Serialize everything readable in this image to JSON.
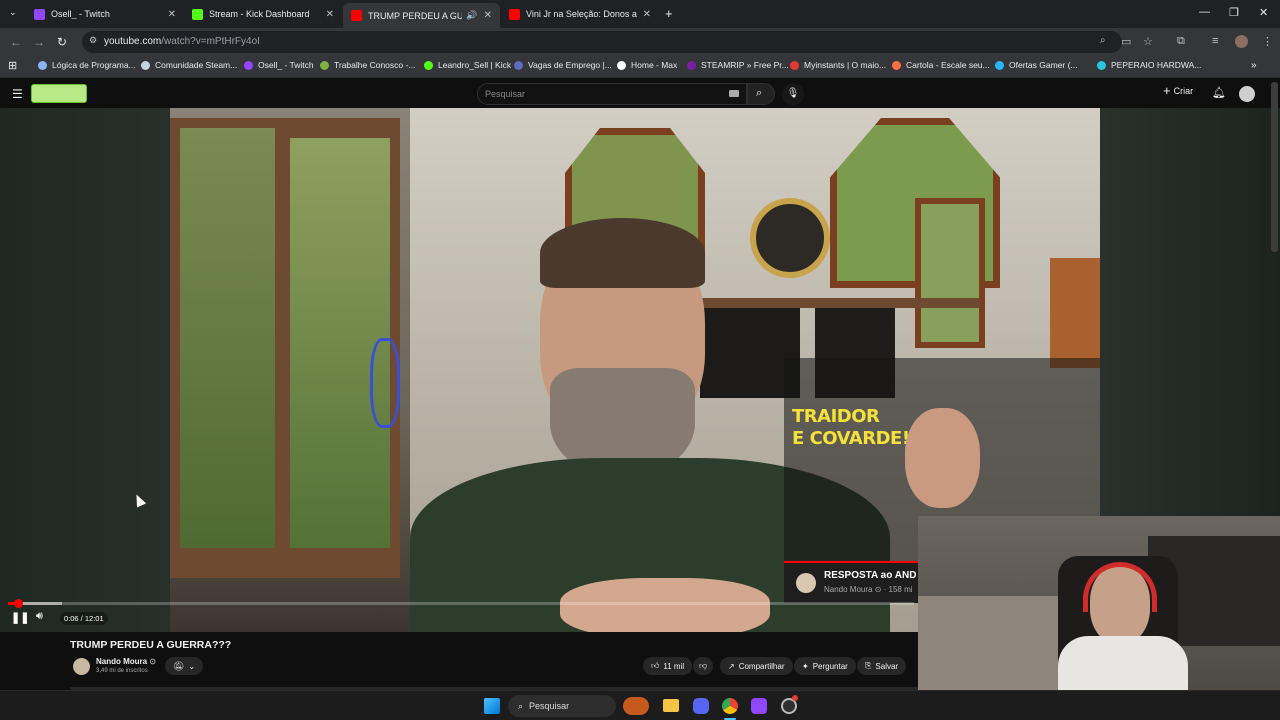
{
  "browser": {
    "tabs": [
      {
        "label": "Osell_ - Twitch",
        "color": "#9146ff"
      },
      {
        "label": "Stream - Kick Dashboard",
        "color": "#53fc18"
      },
      {
        "label": "TRUMP PERDEU A GUERRA",
        "color": "#ff0000"
      },
      {
        "label": "Vini Jr na Seleção: Donos anali",
        "color": "#ff0000"
      }
    ],
    "url_host": "youtube.com",
    "url_path": "/watch?v=mPtHrFy4oI",
    "bookmarks": [
      {
        "label": "Lógica de Programa...",
        "color": "#8ab4f8"
      },
      {
        "label": "Comunidade Steam...",
        "color": "#c6d4df"
      },
      {
        "label": "Osell_ - Twitch",
        "color": "#9146ff"
      },
      {
        "label": "Trabalhe Conosco -...",
        "color": "#7cb342"
      },
      {
        "label": "Leandro_Sell | Kick",
        "color": "#53fc18"
      },
      {
        "label": "Vagas de Emprego |...",
        "color": "#5c6bc0"
      },
      {
        "label": "Home - Max",
        "color": "#ffffff"
      },
      {
        "label": "STEAMRIP » Free Pr...",
        "color": "#7b1fa2"
      },
      {
        "label": "Myinstants | O maio...",
        "color": "#e53935"
      },
      {
        "label": "Cartola - Escale seu...",
        "color": "#ff7043"
      },
      {
        "label": "Ofertas Gamer (...",
        "color": "#29b6f6"
      },
      {
        "label": "PEPERAIO HARDWA...",
        "color": "#26c6da"
      }
    ]
  },
  "youtube": {
    "search_placeholder": "Pesquisar",
    "create_label": "Criar",
    "video_time": "0:06 / 12:01",
    "progress_fraction": 0.008,
    "overlay_title_line1": "TRAIDOR",
    "overlay_title_line2": "E COVARDE!",
    "suggestion_title": "RESPOSTA ao AND",
    "suggestion_meta": "Nando Moura ⊙ · 158 mi",
    "video_title": "TRUMP PERDEU A GUERRA???",
    "channel_name": "Nando Moura",
    "channel_subs": "3,49 mi de inscritos",
    "like_count": "11 mil",
    "share_label": "Compartilhar",
    "ask_label": "Perguntar",
    "save_label": "Salvar"
  },
  "taskbar": {
    "search_label": "Pesquisar"
  }
}
